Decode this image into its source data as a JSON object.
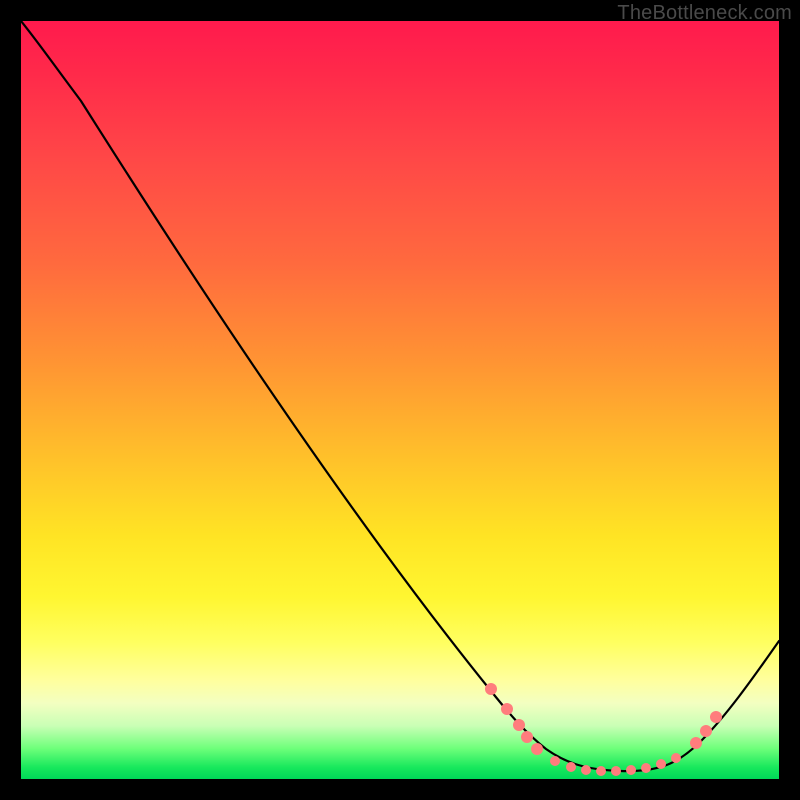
{
  "attribution": "TheBottleneck.com",
  "chart_data": {
    "type": "line",
    "title": "",
    "xlabel": "",
    "ylabel": "",
    "xlim": [
      0,
      100
    ],
    "ylim": [
      0,
      100
    ],
    "series": [
      {
        "name": "curve",
        "x": [
          0,
          4,
          8,
          12,
          16,
          20,
          24,
          28,
          32,
          36,
          40,
          44,
          48,
          52,
          56,
          60,
          63,
          66,
          69,
          72,
          75,
          78,
          81,
          84,
          87,
          90,
          93,
          96,
          100
        ],
        "y": [
          100,
          98,
          95,
          91,
          86,
          80,
          74,
          68,
          62,
          56,
          50,
          44,
          38,
          32,
          26,
          20,
          15,
          11,
          7,
          4,
          2,
          1,
          1,
          1,
          2,
          4,
          7,
          12,
          18
        ]
      }
    ],
    "markers": {
      "name": "dots",
      "color": "#ff7d7d",
      "points": [
        {
          "x": 60,
          "y": 20
        },
        {
          "x": 63,
          "y": 15
        },
        {
          "x": 65,
          "y": 10
        },
        {
          "x": 67,
          "y": 7
        },
        {
          "x": 69,
          "y": 5
        },
        {
          "x": 72,
          "y": 2
        },
        {
          "x": 74,
          "y": 1.5
        },
        {
          "x": 76,
          "y": 1.2
        },
        {
          "x": 78,
          "y": 1.1
        },
        {
          "x": 80,
          "y": 1.1
        },
        {
          "x": 82,
          "y": 1.3
        },
        {
          "x": 84,
          "y": 1.8
        },
        {
          "x": 86,
          "y": 2.6
        },
        {
          "x": 88,
          "y": 4
        },
        {
          "x": 90,
          "y": 6
        },
        {
          "x": 91,
          "y": 8
        },
        {
          "x": 92,
          "y": 10
        }
      ]
    }
  }
}
